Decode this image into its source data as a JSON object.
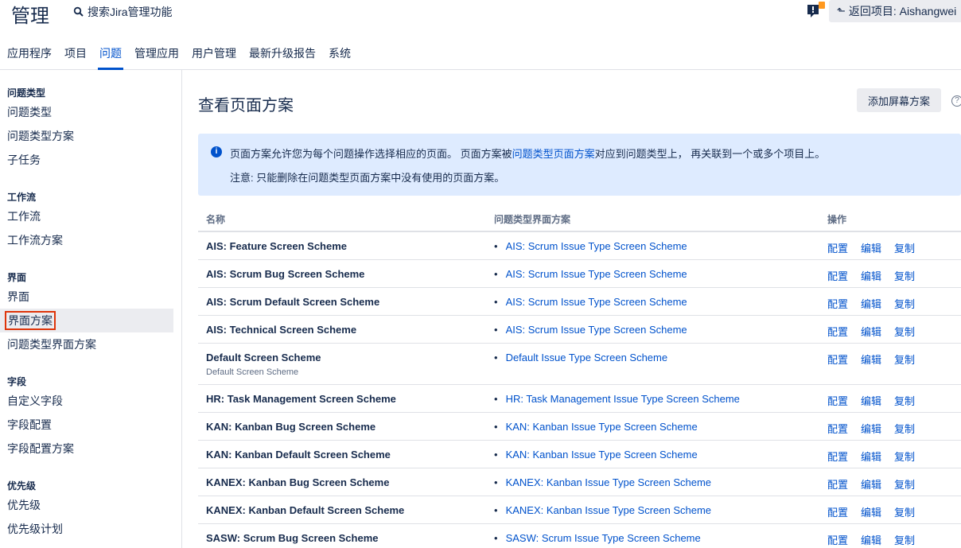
{
  "header": {
    "title": "管理",
    "search_text": "搜索Jira管理功能",
    "back_label": "返回项目: Aishangwei"
  },
  "nav": [
    {
      "label": "应用程序"
    },
    {
      "label": "项目"
    },
    {
      "label": "问题",
      "active": true
    },
    {
      "label": "管理应用"
    },
    {
      "label": "用户管理"
    },
    {
      "label": "最新升级报告"
    },
    {
      "label": "系统"
    }
  ],
  "sidebar": {
    "groups": [
      {
        "heading": "问题类型",
        "items": [
          "问题类型",
          "问题类型方案",
          "子任务"
        ]
      },
      {
        "heading": "工作流",
        "items": [
          "工作流",
          "工作流方案"
        ]
      },
      {
        "heading": "界面",
        "items": [
          "界面",
          "界面方案",
          "问题类型界面方案"
        ]
      },
      {
        "heading": "字段",
        "items": [
          "自定义字段",
          "字段配置",
          "字段配置方案"
        ]
      },
      {
        "heading": "优先级",
        "items": [
          "优先级",
          "优先级计划"
        ]
      }
    ],
    "selected": "界面方案"
  },
  "main": {
    "title": "查看页面方案",
    "add_button": "添加屏幕方案",
    "info": {
      "line1_prefix": "页面方案允许您为每个问题操作选择相应的页面。 页面方案被",
      "line1_link": "问题类型页面方案",
      "line1_suffix": "对应到问题类型上， 再关联到一个或多个项目上。",
      "line2": "注意: 只能删除在问题类型页面方案中没有使用的页面方案。"
    },
    "table": {
      "headers": {
        "name": "名称",
        "scheme": "问题类型界面方案",
        "ops": "操作"
      },
      "ops_labels": {
        "configure": "配置",
        "edit": "编辑",
        "copy": "复制"
      },
      "rows": [
        {
          "name": "AIS: Feature Screen Scheme",
          "scheme": "AIS: Scrum Issue Type Screen Scheme"
        },
        {
          "name": "AIS: Scrum Bug Screen Scheme",
          "scheme": "AIS: Scrum Issue Type Screen Scheme"
        },
        {
          "name": "AIS: Scrum Default Screen Scheme",
          "scheme": "AIS: Scrum Issue Type Screen Scheme"
        },
        {
          "name": "AIS: Technical Screen Scheme",
          "scheme": "AIS: Scrum Issue Type Screen Scheme"
        },
        {
          "name": "Default Screen Scheme",
          "desc": "Default Screen Scheme",
          "scheme": "Default Issue Type Screen Scheme"
        },
        {
          "name": "HR: Task Management Screen Scheme",
          "scheme": "HR: Task Management Issue Type Screen Scheme"
        },
        {
          "name": "KAN: Kanban Bug Screen Scheme",
          "scheme": "KAN: Kanban Issue Type Screen Scheme"
        },
        {
          "name": "KAN: Kanban Default Screen Scheme",
          "scheme": "KAN: Kanban Issue Type Screen Scheme"
        },
        {
          "name": "KANEX: Kanban Bug Screen Scheme",
          "scheme": "KANEX: Kanban Issue Type Screen Scheme"
        },
        {
          "name": "KANEX: Kanban Default Screen Scheme",
          "scheme": "KANEX: Kanban Issue Type Screen Scheme"
        },
        {
          "name": "SASW: Scrum Bug Screen Scheme",
          "scheme": "SASW: Scrum Issue Type Screen Scheme"
        }
      ]
    }
  },
  "colors": {
    "link": "#0052cc",
    "text": "#172b4d",
    "info_bg": "#deebff",
    "selected_outline": "#de350b"
  }
}
